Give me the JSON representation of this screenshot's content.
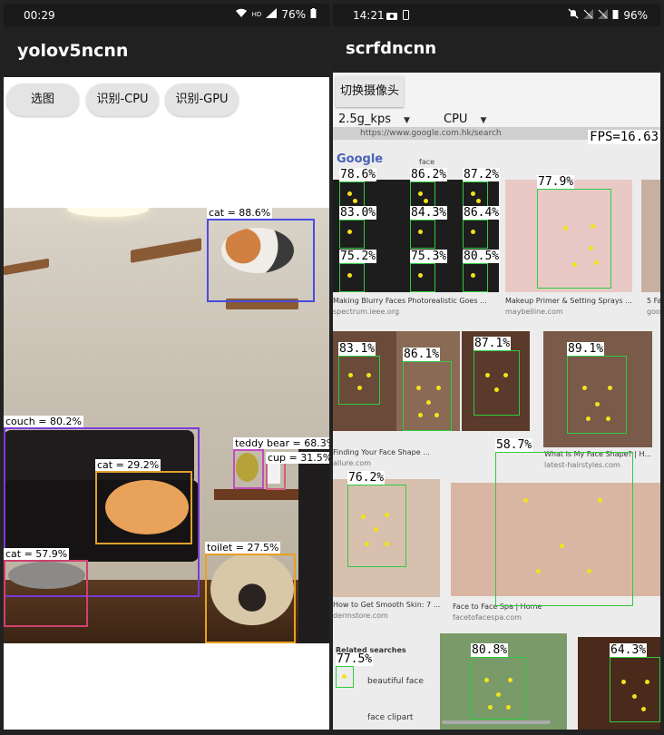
{
  "left": {
    "status": {
      "time": "00:29",
      "battery": "76%",
      "net": "HD"
    },
    "app_title": "yolov5ncnn",
    "buttons": {
      "select_image": "选图",
      "detect_cpu": "识别-CPU",
      "detect_gpu": "识别-GPU"
    },
    "detections": [
      {
        "label": "cat = 88.6%"
      },
      {
        "label": "couch = 80.2%"
      },
      {
        "label": "teddy bear = 68.3%"
      },
      {
        "label": "cup = 31.5%"
      },
      {
        "label": "cat = 29.2%"
      },
      {
        "label": "toilet = 27.5%"
      },
      {
        "label": "cat = 57.9%"
      }
    ],
    "colors": {
      "cat_box": "#4a4ae0",
      "couch_box": "#7a3ad6",
      "teddy_box": "#c04ec0",
      "cup_box": "#d06080",
      "cat2_box": "#e0a030",
      "toilet_box": "#e8a020",
      "cat3_box": "#d04070"
    }
  },
  "right": {
    "status": {
      "time": "14:21",
      "battery": "96%"
    },
    "app_title": "scrfdncnn",
    "switch_camera": "切换摄像头",
    "model_select": "2.5g_kps",
    "device_select": "CPU",
    "fps": "FPS=16.63",
    "google_logo": "Google",
    "search_query": "face",
    "url_text": "https://www.google.com.hk/search",
    "captions": [
      "Making Blurry Faces Photorealistic Goes ...",
      "spectrum.ieee.org",
      "Makeup Primer & Setting Sprays ...",
      "maybelline.com",
      "5 Fa",
      "goo",
      "Finding Your Face Shape ...",
      "allure.com",
      "What Is My Face Shape? | H...",
      "latest-hairstyles.com",
      "How to Get Smooth Skin: 7 ...",
      "dermstore.com",
      "Face to Face Spa | Home",
      "facetofacespa.com",
      "Related searches",
      "beautiful face",
      "face clipart"
    ],
    "faces": [
      {
        "label": "78.6%"
      },
      {
        "label": "86.2%"
      },
      {
        "label": "87.2%"
      },
      {
        "label": "83.0%"
      },
      {
        "label": "84.3%"
      },
      {
        "label": "86.4%"
      },
      {
        "label": "75.2%"
      },
      {
        "label": "75.3%"
      },
      {
        "label": "80.5%"
      },
      {
        "label": "77.9%"
      },
      {
        "label": "83.1%"
      },
      {
        "label": "86.1%"
      },
      {
        "label": "87.1%"
      },
      {
        "label": "89.1%"
      },
      {
        "label": "58.7%"
      },
      {
        "label": "76.2%"
      },
      {
        "label": "77.5%"
      },
      {
        "label": "80.8%"
      },
      {
        "label": "64.3%"
      }
    ],
    "colors": {
      "face_box": "#2ecc40",
      "landmark": "#f4e21a"
    }
  }
}
